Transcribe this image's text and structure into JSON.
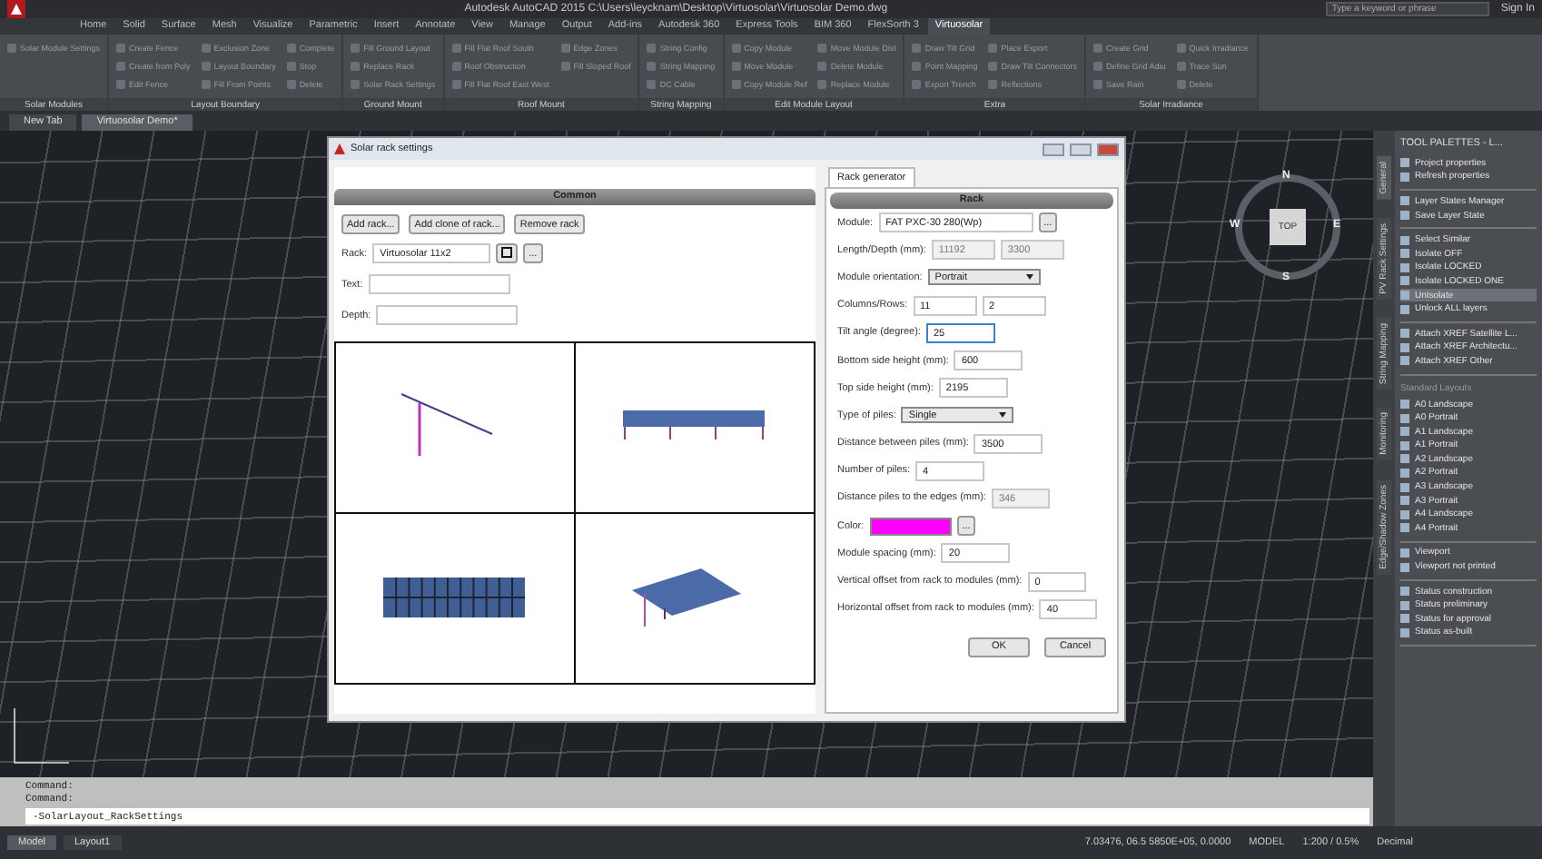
{
  "window": {
    "title": "Autodesk AutoCAD 2015   C:\\Users\\leycknam\\Desktop\\Virtuosolar\\Virtuosolar Demo.dwg",
    "search": {
      "placeholder": "Type a keyword or phrase"
    },
    "sign_in": "Sign In"
  },
  "ribbon_tabs": [
    {
      "label": "Home",
      "selected": false
    },
    {
      "label": "Solid",
      "selected": false
    },
    {
      "label": "Surface",
      "selected": false
    },
    {
      "label": "Mesh",
      "selected": false
    },
    {
      "label": "Visualize",
      "selected": false
    },
    {
      "label": "Parametric",
      "selected": false
    },
    {
      "label": "Insert",
      "selected": false
    },
    {
      "label": "Annotate",
      "selected": false
    },
    {
      "label": "View",
      "selected": false
    },
    {
      "label": "Manage",
      "selected": false
    },
    {
      "label": "Output",
      "selected": false
    },
    {
      "label": "Add-ins",
      "selected": false
    },
    {
      "label": "Autodesk 360",
      "selected": false
    },
    {
      "label": "Express Tools",
      "selected": false
    },
    {
      "label": "BIM 360",
      "selected": false
    },
    {
      "label": "FlexSorth 3",
      "selected": false
    },
    {
      "label": "Virtuosolar",
      "selected": true
    }
  ],
  "ribbon_panels": [
    {
      "title": "Solar Modules",
      "buttons": [
        "Solar Module Settings"
      ]
    },
    {
      "title": "Layout Boundary",
      "buttons": [
        "Create Fence",
        "Create from Poly",
        "Edit Fence",
        "Exclusion Zone",
        "Layout Boundary",
        "Fill From Points",
        "Complete",
        "Stop",
        "Delete"
      ]
    },
    {
      "title": "Ground Mount",
      "buttons": [
        "Fill Ground Layout",
        "Replace Rack",
        "Solar Rack Settings"
      ]
    },
    {
      "title": "Roof Mount",
      "buttons": [
        "Fill Flat Roof South",
        "Roof Obstruction",
        "Fill Flat Roof East West",
        "Edge Zones",
        "Fill Sloped Roof"
      ]
    },
    {
      "title": "String Mapping",
      "buttons": [
        "String Config",
        "String Mapping",
        "DC Cable"
      ]
    },
    {
      "title": "Edit Module Layout",
      "buttons": [
        "Copy Module",
        "Move Module",
        "Copy Module Ref",
        "Move Module Dist",
        "Delete Module",
        "Replace Module"
      ]
    },
    {
      "title": "Extra",
      "buttons": [
        "Draw Tilt Grid",
        "Point Mapping",
        "Export Trench",
        "Place Export",
        "Draw Tilt Connectors",
        "Reflections"
      ]
    },
    {
      "title": "Solar Irradiance",
      "buttons": [
        "Create Grid",
        "Define Grid Adiu",
        "Save Rain",
        "Quick Irradiance",
        "Trace Sun",
        "Delete"
      ]
    }
  ],
  "file_tabs": [
    {
      "label": "New Tab",
      "selected": false
    },
    {
      "label": "Virtuosolar Demo*",
      "selected": true
    }
  ],
  "viewcube": {
    "top": "TOP",
    "north": "N",
    "south": "S",
    "east": "E",
    "west": "W"
  },
  "dialog": {
    "title": "Solar rack settings",
    "common": {
      "header": "Common",
      "buttons": [
        "Add rack...",
        "Add clone of rack...",
        "Remove rack"
      ],
      "rack": {
        "label": "Rack:",
        "value": "Virtuosolar 11x2",
        "browse": "..."
      },
      "fields": [
        {
          "label": "Text:"
        },
        {
          "label": "Depth:"
        }
      ]
    },
    "tabs": [
      {
        "label": "Rack generator",
        "selected": true
      }
    ],
    "rack": {
      "header": "Rack",
      "rows": [
        {
          "kind": "text",
          "label": "Module:",
          "fields": [
            {
              "value": "FAT PXC-30 280(Wp)",
              "disabled": false,
              "focused": false
            }
          ],
          "browse": "..."
        },
        {
          "kind": "text",
          "label": "Length/Depth (mm):",
          "fields": [
            {
              "value": "11192",
              "disabled": true,
              "focused": false
            },
            {
              "value": "3300",
              "disabled": true,
              "focused": false
            }
          ]
        },
        {
          "kind": "select",
          "label": "Module orientation:",
          "value": "Portrait"
        },
        {
          "kind": "text",
          "label": "Columns/Rows:",
          "fields": [
            {
              "value": "11",
              "disabled": false,
              "focused": false
            },
            {
              "value": "2",
              "disabled": false,
              "focused": false
            }
          ]
        },
        {
          "kind": "text",
          "label": "Tilt angle (degree):",
          "fields": [
            {
              "value": "25",
              "disabled": false,
              "focused": true
            }
          ]
        },
        {
          "kind": "text",
          "label": "Bottom side height (mm):",
          "fields": [
            {
              "value": "600",
              "disabled": false,
              "focused": false
            }
          ]
        },
        {
          "kind": "text",
          "label": "Top side height (mm):",
          "fields": [
            {
              "value": "2195",
              "disabled": false,
              "focused": false
            }
          ]
        },
        {
          "kind": "select",
          "label": "Type of piles:",
          "value": "Single"
        },
        {
          "kind": "text",
          "label": "Distance between piles (mm):",
          "fields": [
            {
              "value": "3500",
              "disabled": false,
              "focused": false
            }
          ]
        },
        {
          "kind": "text",
          "label": "Number of piles:",
          "fields": [
            {
              "value": "4",
              "disabled": false,
              "focused": false
            }
          ]
        },
        {
          "kind": "text",
          "label": "Distance piles to the edges (mm):",
          "fields": [
            {
              "value": "346",
              "disabled": true,
              "focused": false
            }
          ]
        },
        {
          "kind": "color",
          "label": "Color:",
          "color": "#ff00ff",
          "browse": "..."
        },
        {
          "kind": "text",
          "label": "Module spacing (mm):",
          "fields": [
            {
              "value": "20",
              "disabled": false,
              "focused": false
            }
          ]
        },
        {
          "kind": "text",
          "label": "Vertical offset from rack to modules (mm):",
          "fields": [
            {
              "value": "0",
              "disabled": false,
              "focused": false
            }
          ]
        },
        {
          "kind": "text",
          "label": "Horizontal offset from rack to modules (mm):",
          "fields": [
            {
              "value": "40",
              "disabled": false,
              "focused": false
            }
          ]
        }
      ]
    },
    "buttons": [
      "OK",
      "Cancel"
    ]
  },
  "tool_palette": {
    "title": "TOOL PALETTES - L...",
    "side_tabs": [
      {
        "label": "General",
        "selected": true
      },
      {
        "label": "PV Rack Settings",
        "selected": false
      },
      {
        "label": "String Mapping",
        "selected": false
      },
      {
        "label": "Monitoring",
        "selected": false
      },
      {
        "label": "Edge/Shadow Zones",
        "selected": false
      }
    ],
    "groups": [
      {
        "items": [
          {
            "label": "Project properties",
            "selected": false
          },
          {
            "label": "Refresh properties",
            "selected": false
          }
        ]
      },
      {
        "items": [
          {
            "label": "Layer States Manager",
            "selected": false
          },
          {
            "label": "Save Layer State",
            "selected": false
          }
        ]
      },
      {
        "items": [
          {
            "label": "Select Similar",
            "selected": false
          },
          {
            "label": "Isolate OFF",
            "selected": false
          },
          {
            "label": "Isolate LOCKED",
            "selected": false
          },
          {
            "label": "Isolate LOCKED ONE",
            "selected": false
          },
          {
            "label": "UnIsolate",
            "selected": true
          },
          {
            "label": "Unlock ALL layers",
            "selected": false
          }
        ]
      },
      {
        "items": [
          {
            "label": "Attach XREF Satellite L...",
            "selected": false
          },
          {
            "label": "Attach XREF Architectu...",
            "selected": false
          },
          {
            "label": "Attach XREF Other",
            "selected": false
          }
        ]
      },
      {
        "heading": "Standard Layouts",
        "items": [
          {
            "label": "A0 Landscape",
            "selected": false
          },
          {
            "label": "A0 Portrait",
            "selected": false
          },
          {
            "label": "A1 Landscape",
            "selected": false
          },
          {
            "label": "A1 Portrait",
            "selected": false
          },
          {
            "label": "A2 Landscape",
            "selected": false
          },
          {
            "label": "A2 Portrait",
            "selected": false
          },
          {
            "label": "A3 Landscape",
            "selected": false
          },
          {
            "label": "A3 Portrait",
            "selected": false
          },
          {
            "label": "A4 Landscape",
            "selected": false
          },
          {
            "label": "A4 Portrait",
            "selected": false
          }
        ]
      },
      {
        "items": [
          {
            "label": "Viewport",
            "selected": false
          },
          {
            "label": "Viewport not printed",
            "selected": false
          }
        ]
      },
      {
        "items": [
          {
            "label": "Status construction",
            "selected": false
          },
          {
            "label": "Status preliminary",
            "selected": false
          },
          {
            "label": "Status for approval",
            "selected": false
          },
          {
            "label": "Status as-built",
            "selected": false
          }
        ]
      }
    ]
  },
  "command_line": {
    "history": [
      "Command:",
      "Command:"
    ],
    "input": "-SolarLayout_RackSettings"
  },
  "layout_tabs": [
    {
      "label": "Model",
      "selected": true
    },
    {
      "label": "Layout1",
      "selected": false
    }
  ],
  "status_bar": {
    "coordinates": "7.03476, 06.5 5850E+05, 0.0000",
    "space": "MODEL",
    "scale": "1:200 / 0.5%",
    "units": "Decimal"
  }
}
